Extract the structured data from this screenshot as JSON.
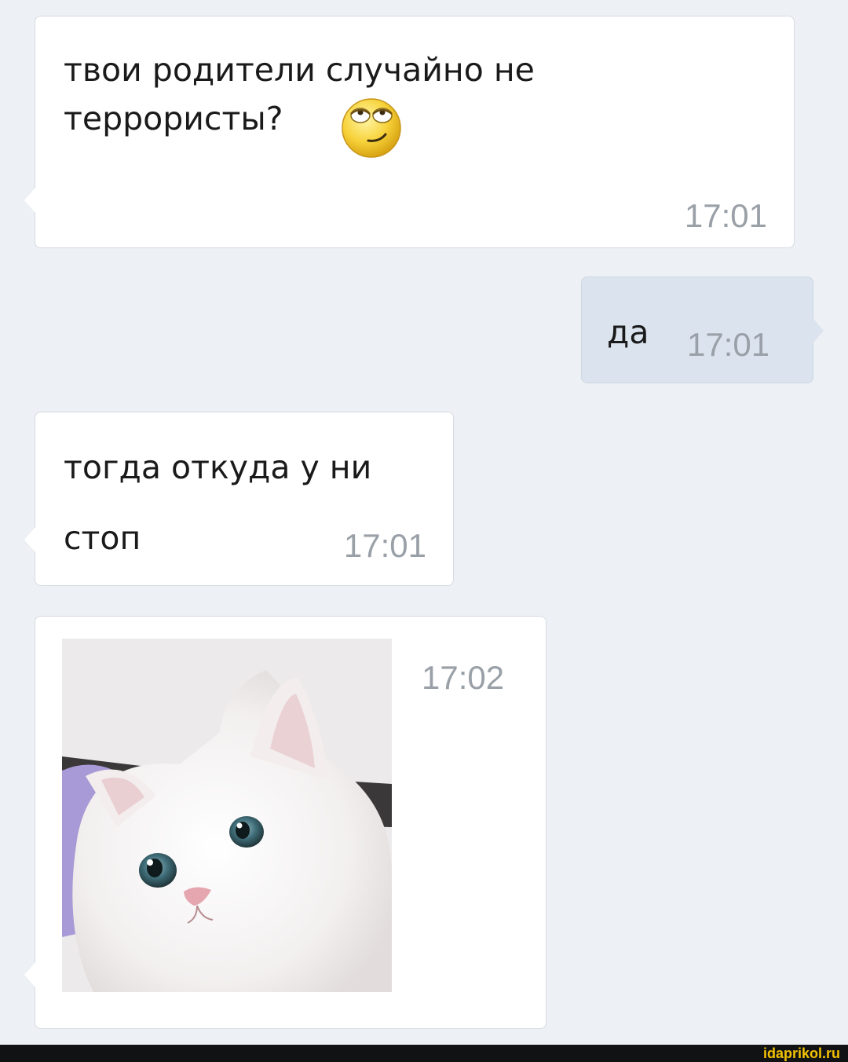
{
  "messages": [
    {
      "direction": "incoming",
      "lines": [
        "твои родители случайно не",
        "террористы?"
      ],
      "emoji": "rolling-eyes-smirk-emoji",
      "time": "17:01"
    },
    {
      "direction": "outgoing",
      "text": "да",
      "time": "17:01"
    },
    {
      "direction": "incoming",
      "lines": [
        "тогда откуда у ни",
        "стоп"
      ],
      "time": "17:01"
    },
    {
      "direction": "incoming",
      "image": "white-cat-photo",
      "time": "17:02"
    }
  ],
  "watermark": "idaprikol.ru",
  "colors": {
    "background": "#edf0f4",
    "incoming_bubble": "#ffffff",
    "outgoing_bubble": "#dbe3ee",
    "timestamp": "#9aa0a7",
    "watermark": "#f2c200"
  }
}
